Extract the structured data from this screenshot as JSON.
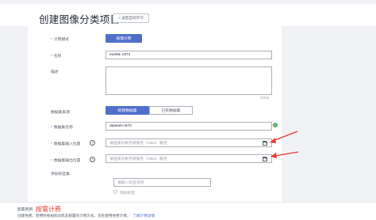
{
  "header": {
    "title": "创建图像分类项目",
    "back_label": "< 返回自动学习"
  },
  "form": {
    "billing_mode": {
      "label": "计费模式",
      "value": "按需计费"
    },
    "name": {
      "label": "名称",
      "value": "exeML-c672"
    },
    "description": {
      "label": "描述",
      "counter": "0/256"
    },
    "dataset_source": {
      "label": "数据集来源",
      "option_new": "新建数据集",
      "option_existing": "已有数据集"
    },
    "dataset_name": {
      "label": "数据集名称",
      "value": "dataset-c672"
    },
    "input_location": {
      "label": "数据集输入位置",
      "placeholder": "请选择对象存储服务（OBS）路径"
    },
    "output_location": {
      "label": "数据集输出位置",
      "placeholder": "请选择对象存储服务（OBS）路径"
    },
    "add_tag_set": {
      "label": "添加标签集",
      "input_placeholder": "请输入标签名称",
      "add_label": "添加标签"
    }
  },
  "footer": {
    "config_label": "配置费用",
    "config_value": "按需计费",
    "description": "创建免费，使用时按按照训练及部署的计费方式。优先使用免费计费。",
    "link": "了解计费详情"
  },
  "colors": {
    "primary": "#526ecc",
    "required": "#e53935",
    "annotation_arrow": "#e53935",
    "success": "#50b06c"
  }
}
